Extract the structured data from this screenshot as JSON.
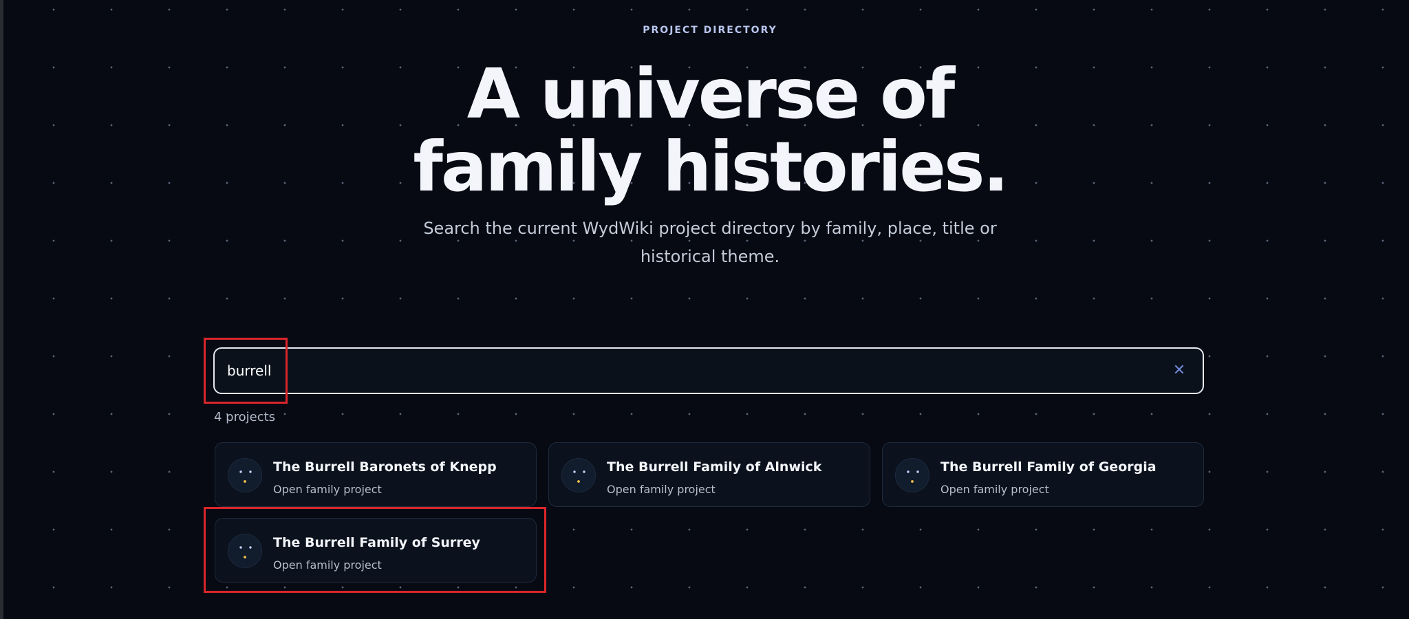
{
  "header": {
    "eyebrow": "PROJECT DIRECTORY",
    "title": "A universe of family histories.",
    "subtitle": "Search the current WydWiki project directory by family, place, title or historical theme."
  },
  "search": {
    "value": "burrell",
    "clear_icon": "close-icon",
    "clear_glyph": "✕"
  },
  "results": {
    "count_label": "4 projects",
    "items": [
      {
        "title": "The Burrell Baronets of Knepp",
        "subtitle": "Open family project",
        "icon": "constellation-icon"
      },
      {
        "title": "The Burrell Family of Alnwick",
        "subtitle": "Open family project",
        "icon": "constellation-icon"
      },
      {
        "title": "The Burrell Family of Georgia",
        "subtitle": "Open family project",
        "icon": "constellation-icon"
      },
      {
        "title": "The Burrell Family of Surrey",
        "subtitle": "Open family project",
        "icon": "constellation-icon"
      }
    ]
  },
  "colors": {
    "background": "#070a12",
    "accent": "#6f86d6",
    "highlight": "#d9262b"
  }
}
